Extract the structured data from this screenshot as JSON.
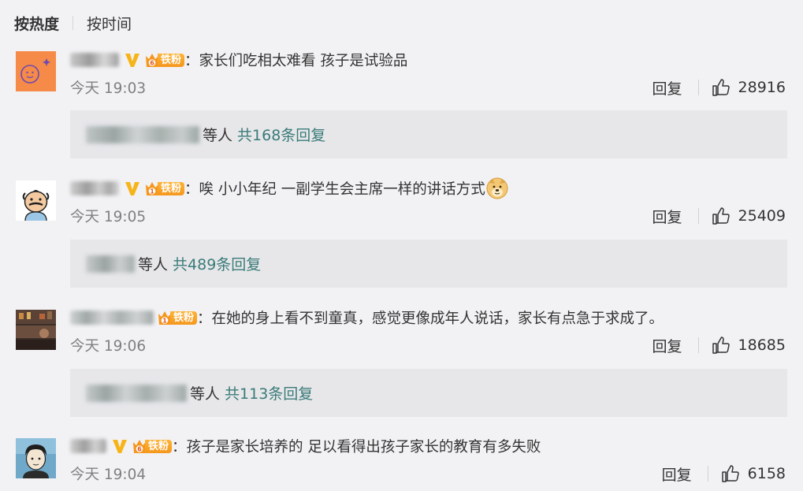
{
  "sort_bar": {
    "hot_label": "按热度",
    "time_label": "按时间"
  },
  "comments": [
    {
      "user": "[blurred]",
      "fan_level": "6",
      "fan_label": "铁粉",
      "text": "：家长们吃相太难看 孩子是试验品",
      "time": "今天 19:03",
      "reply_label": "回复",
      "likes": "28916",
      "replies_prefix": "等人",
      "replies_count": "共168条回复"
    },
    {
      "user": "[blurred]",
      "fan_level": "1",
      "fan_label": "铁粉",
      "text": "：唉 小小年纪 一副学生会主席一样的讲话方式",
      "emoji": "doge-emoji",
      "time": "今天 19:05",
      "reply_label": "回复",
      "likes": "25409",
      "replies_prefix": "等人",
      "replies_count": "共489条回复"
    },
    {
      "user": "[blurred]",
      "fan_level": "1",
      "fan_label": "铁粉",
      "text": "：在她的身上看不到童真，感觉更像成年人说话，家长有点急于求成了。",
      "time": "今天 19:06",
      "reply_label": "回复",
      "likes": "18685",
      "replies_prefix": "等人",
      "replies_count": "共113条回复"
    },
    {
      "user": "[blurred]",
      "fan_level": "6",
      "fan_label": "铁粉",
      "text": "：孩子是家长培养的 足以看得出孩子家长的教育有多失败",
      "time": "今天 19:04",
      "reply_label": "回复",
      "likes": "6158"
    }
  ],
  "colors": {
    "accent_link": "#3a7b78",
    "v_badge": "#f6b418",
    "fan_badge": "#f5971d",
    "background": "#f2f2f5",
    "replies_bg": "#e7e7ea"
  }
}
